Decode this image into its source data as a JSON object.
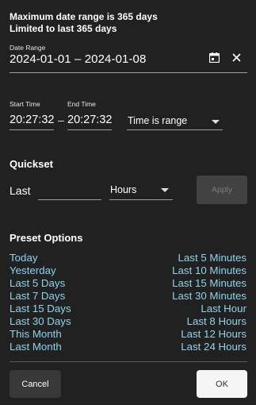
{
  "notices": {
    "max_range": "Maximum date range is 365 days",
    "limit": "Limited to last 365 days"
  },
  "date_range": {
    "label": "Date Range",
    "value": "2024-01-01 – 2024-01-08",
    "calendar_icon": "calendar-icon",
    "clear_icon": "close-icon"
  },
  "time": {
    "start_label": "Start Time",
    "start_value": "20:27:32",
    "separator": "–",
    "end_label": "End Time",
    "end_value": "20:27:32",
    "mode_value": "Time is range"
  },
  "quickset": {
    "title": "Quickset",
    "last_label": "Last",
    "amount_value": "",
    "unit_value": "Hours",
    "apply_label": "Apply"
  },
  "presets": {
    "title": "Preset Options",
    "left": [
      "Today",
      "Yesterday",
      "Last 5 Days",
      "Last 7 Days",
      "Last 15 Days",
      "Last 30 Days",
      "This Month",
      "Last Month"
    ],
    "right": [
      "Last 5 Minutes",
      "Last 10 Minutes",
      "Last 15 Minutes",
      "Last 30 Minutes",
      "Last Hour",
      "Last 8 Hours",
      "Last 12 Hours",
      "Last 24 Hours"
    ]
  },
  "footer": {
    "cancel_label": "Cancel",
    "ok_label": "OK"
  },
  "colors": {
    "background": "#212121",
    "preset_link": "#8fd3ee",
    "apply_disabled": "#424242",
    "ok_background": "#f5f5f5"
  }
}
